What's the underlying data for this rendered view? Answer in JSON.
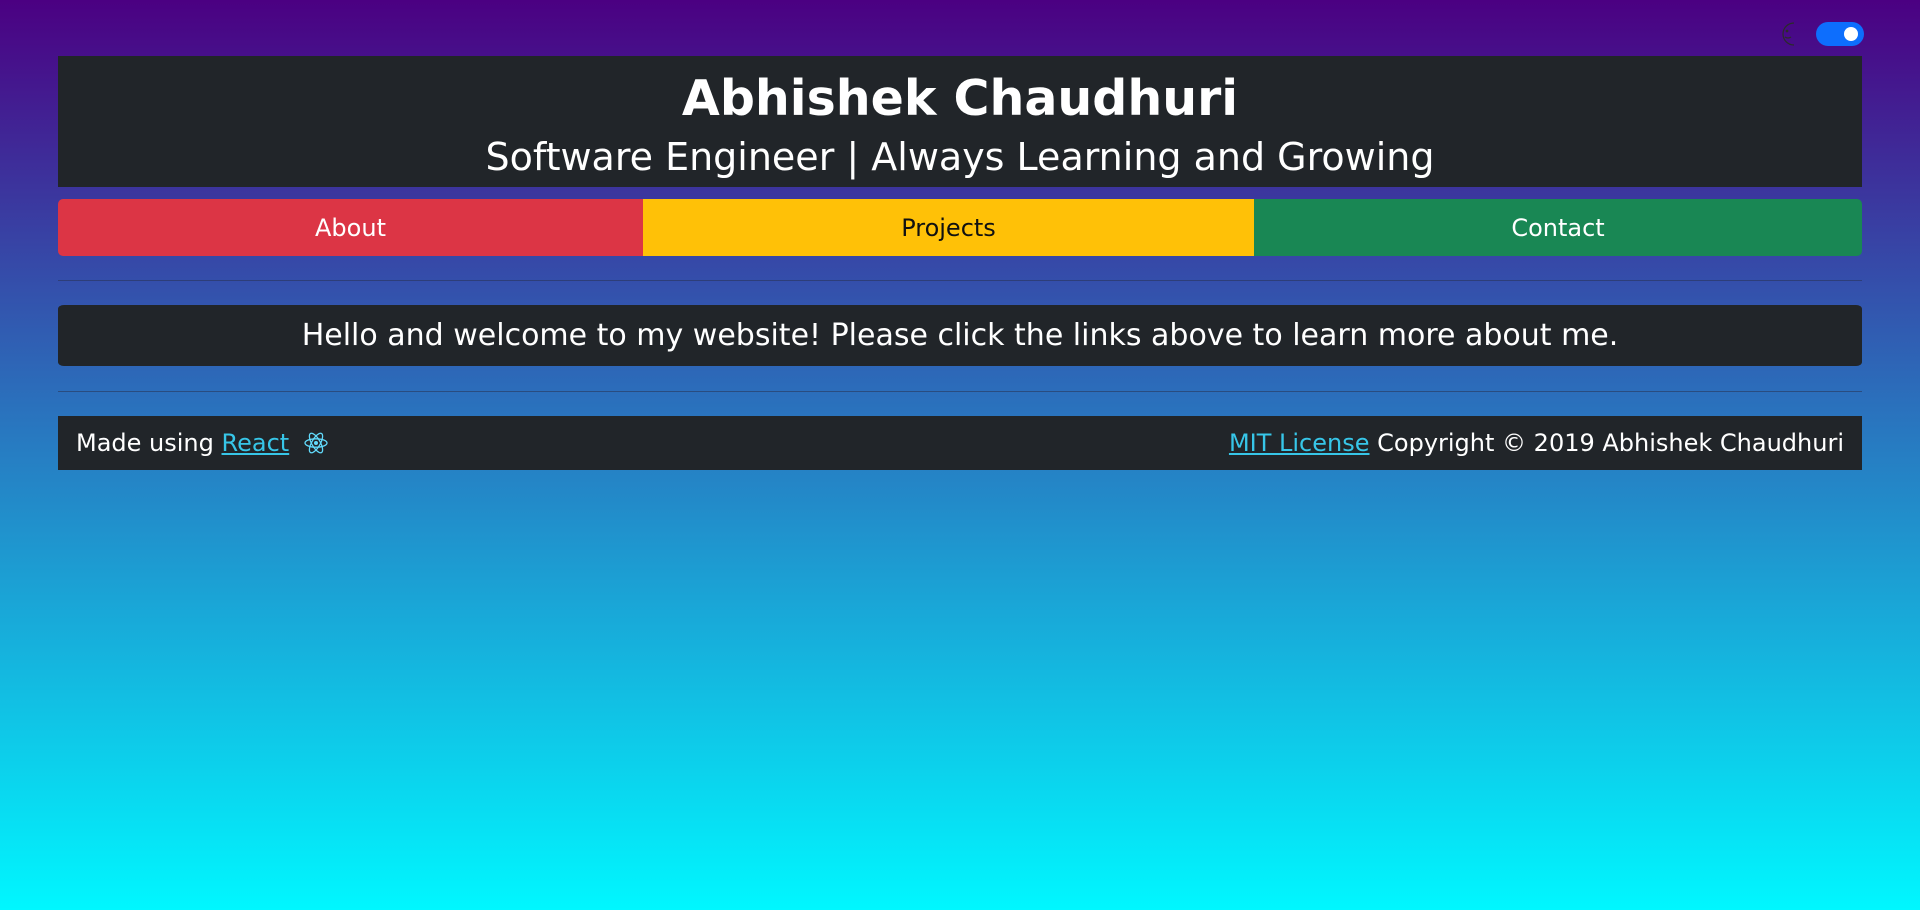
{
  "header": {
    "name": "Abhishek Chaudhuri",
    "tagline": "Software Engineer | Always Learning and Growing"
  },
  "theme_toggle": {
    "icon": "moon-icon",
    "state": "on",
    "accent_color": "#0d6efd"
  },
  "nav": {
    "items": [
      {
        "label": "About",
        "color": "#dc3545"
      },
      {
        "label": "Projects",
        "color": "#ffc107"
      },
      {
        "label": "Contact",
        "color": "#198754"
      }
    ]
  },
  "main": {
    "welcome_text": "Hello and welcome to my website! Please click the links above to learn more about me."
  },
  "footer": {
    "made_using_prefix": "Made using",
    "react_link": "React",
    "react_icon": "react-icon",
    "license_link": "MIT License",
    "copyright": "Copyright © 2019 Abhishek Chaudhuri",
    "link_color": "#37c6e8"
  }
}
